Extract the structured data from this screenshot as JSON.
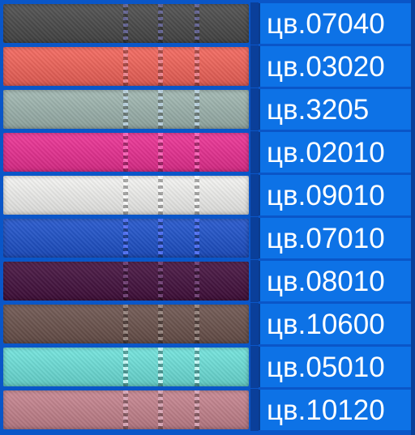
{
  "swatches": [
    {
      "code": "цв.07040",
      "color": "#4a4a4a",
      "stripe": "#6a6aa0"
    },
    {
      "code": "цв.03020",
      "color": "#f4645a",
      "stripe": "#f090a0"
    },
    {
      "code": "цв.3205",
      "color": "#9fb6b0",
      "stripe": "#c0d8e8"
    },
    {
      "code": "цв.02010",
      "color": "#ec2f93",
      "stripe": "#ff6ec0"
    },
    {
      "code": "цв.09010",
      "color": "#f4f4f2",
      "stripe": "#ffffff"
    },
    {
      "code": "цв.07010",
      "color": "#1e52cc",
      "stripe": "#5a78ff"
    },
    {
      "code": "цв.08010",
      "color": "#44103e",
      "stripe": "#7a4a80"
    },
    {
      "code": "цв.10600",
      "color": "#6c534d",
      "stripe": "#a0908a"
    },
    {
      "code": "цв.05010",
      "color": "#6ee3dc",
      "stripe": "#d8ffff"
    },
    {
      "code": "цв.10120",
      "color": "#c6838e",
      "stripe": "#e0b0c0"
    }
  ]
}
